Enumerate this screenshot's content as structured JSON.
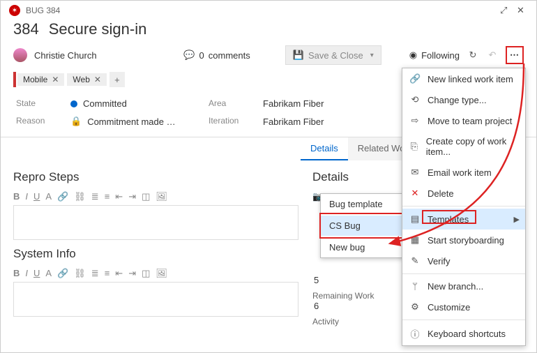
{
  "header": {
    "bug_label": "BUG 384"
  },
  "title": {
    "id": "384",
    "text": "Secure sign-in"
  },
  "meta": {
    "user": "Christie Church",
    "comments_count": "0",
    "comments_label": "comments",
    "save_close": "Save & Close",
    "following": "Following"
  },
  "tags": {
    "items": [
      "Mobile",
      "Web"
    ]
  },
  "fields": {
    "state_label": "State",
    "state": "Committed",
    "reason_label": "Reason",
    "reason": "Commitment made …",
    "area_label": "Area",
    "area": "Fabrikam Fiber",
    "iteration_label": "Iteration",
    "iteration": "Fabrikam Fiber"
  },
  "tabs": {
    "active": "Details",
    "inactive": "Related Work item"
  },
  "left": {
    "repro_title": "Repro Steps",
    "sysinfo_title": "System Info"
  },
  "right": {
    "details_title": "Details",
    "capture": "Capture…",
    "val1": "5",
    "remaining_label": "Remaining Work",
    "val2": "6",
    "activity_label": "Activity"
  },
  "submenu": {
    "items": [
      "Bug template",
      "CS Bug",
      "New bug"
    ],
    "highlight_index": 1
  },
  "ctx": {
    "items": [
      {
        "icon": "link",
        "label": "New linked work item"
      },
      {
        "icon": "change",
        "label": "Change type..."
      },
      {
        "icon": "move",
        "label": "Move to team project"
      },
      {
        "icon": "copy",
        "label": "Create copy of work item..."
      },
      {
        "icon": "mail",
        "label": "Email work item"
      },
      {
        "icon": "delete",
        "label": "Delete"
      },
      {
        "icon": "template",
        "label": "Templates",
        "submenu": true,
        "hl": true
      },
      {
        "icon": "story",
        "label": "Start storyboarding"
      },
      {
        "icon": "verify",
        "label": "Verify"
      },
      {
        "icon": "branch",
        "label": "New branch..."
      },
      {
        "icon": "custom",
        "label": "Customize"
      },
      {
        "icon": "keyboard",
        "label": "Keyboard shortcuts"
      }
    ]
  }
}
